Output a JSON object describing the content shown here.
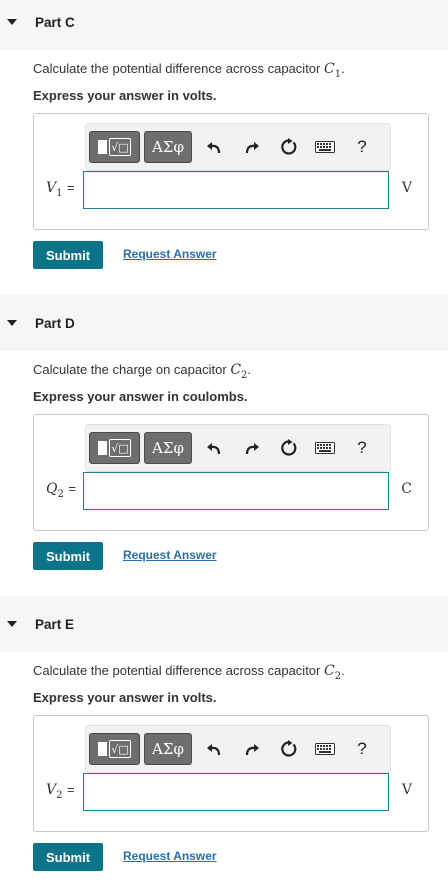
{
  "toolbar": {
    "templates_icon": "templates-icon",
    "greek_label": "ΑΣφ",
    "undo_icon": "undo-icon",
    "redo_icon": "redo-icon",
    "reset_icon": "reset-icon",
    "keyboard_icon": "keyboard-icon",
    "help_label": "?"
  },
  "colors": {
    "submit_bg": "#0c7489",
    "link": "#2a6fa8",
    "input_border": "#1a7f8f",
    "header_bg": "#f6f6f6"
  },
  "parts": [
    {
      "title": "Part C",
      "question_prefix": "Calculate the potential difference across capacitor",
      "question_var": "C",
      "question_sub": "1",
      "question_suffix": ".",
      "instruction": "Express your answer in volts.",
      "var": "V",
      "var_sub": "1",
      "eq": "=",
      "input_value": "",
      "unit": "V",
      "submit": "Submit",
      "request": "Request Answer"
    },
    {
      "title": "Part D",
      "question_prefix": "Calculate the charge on capacitor",
      "question_var": "C",
      "question_sub": "2",
      "question_suffix": ".",
      "instruction": "Express your answer in coulombs.",
      "var": "Q",
      "var_sub": "2",
      "eq": "=",
      "input_value": "",
      "unit": "C",
      "submit": "Submit",
      "request": "Request Answer"
    },
    {
      "title": "Part E",
      "question_prefix": "Calculate the potential difference across capacitor",
      "question_var": "C",
      "question_sub": "2",
      "question_suffix": ".",
      "instruction": "Express your answer in volts.",
      "var": "V",
      "var_sub": "2",
      "eq": "=",
      "input_value": "",
      "unit": "V",
      "submit": "Submit",
      "request": "Request Answer"
    }
  ]
}
